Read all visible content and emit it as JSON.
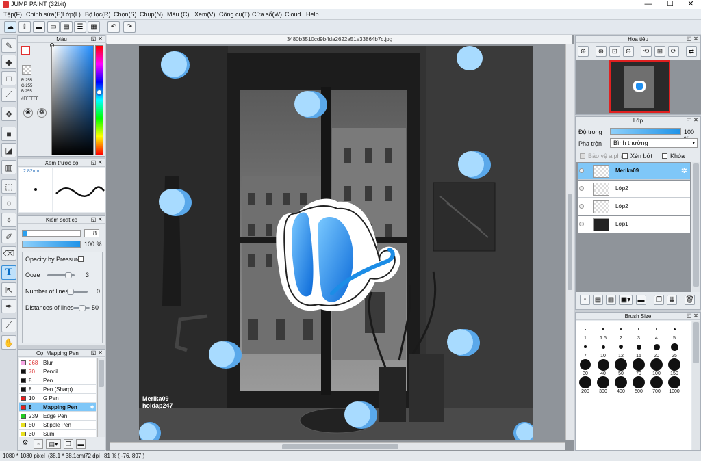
{
  "app": {
    "title": "JUMP PAINT (32bit)"
  },
  "window": {
    "minimize": "—",
    "maximize": "☐",
    "close": "✕"
  },
  "menu": [
    "Tệp(F)",
    "Chỉnh sửa(E)",
    "Lớp(L)",
    "Bộ lọc(R)",
    "Chọn(S)",
    "Chụp(N)",
    "Màu (C)",
    "Xem(V)",
    "Công cụ(T)",
    "Cửa sổ(W)",
    "Cloud",
    "Help"
  ],
  "toolbar": {
    "undo_icon": "undo-icon",
    "redo_icon": "redo-icon"
  },
  "color": {
    "title": "Màu",
    "r": "R:255",
    "g": "G:255",
    "b": "B:255",
    "hex": "#FFFFFF",
    "fg": "#ffffff",
    "accent": "#e03030"
  },
  "preview": {
    "title": "Xem trước cọ",
    "size": "2.82mm"
  },
  "brush_control": {
    "title": "Kiểm soát cọ",
    "size_value": "8",
    "opacity_value": "100 %",
    "opacity_pressure": "Opacity by Pressure",
    "ooze_label": "Ooze",
    "ooze_value": "3",
    "lines_label": "Number of lines",
    "lines_value": "0",
    "dist_label": "Distances of lines",
    "dist_value": "50"
  },
  "brushes": {
    "title": "Cọ: Mapping Pen",
    "items": [
      {
        "size": "268",
        "name": "Blur",
        "color": "#f7a8e6",
        "sizecolor": "#d33"
      },
      {
        "size": "70",
        "name": "Pencil",
        "color": "#111111",
        "sizecolor": "#d33"
      },
      {
        "size": "8",
        "name": "Pen",
        "color": "#111111",
        "sizecolor": "#111"
      },
      {
        "size": "8",
        "name": "Pen (Sharp)",
        "color": "#111111",
        "sizecolor": "#111"
      },
      {
        "size": "10",
        "name": "G Pen",
        "color": "#e82020",
        "sizecolor": "#111"
      },
      {
        "size": "8",
        "name": "Mapping Pen",
        "color": "#e82020",
        "sizecolor": "#111"
      },
      {
        "size": "239",
        "name": "Edge Pen",
        "color": "#22cc22",
        "sizecolor": "#111"
      },
      {
        "size": "50",
        "name": "Stipple Pen",
        "color": "#e8e020",
        "sizecolor": "#111"
      },
      {
        "size": "30",
        "name": "Sumi",
        "color": "#e8e020",
        "sizecolor": "#111"
      }
    ],
    "selected_index": 5
  },
  "document": {
    "tab": "3480b3510cd9b4da2622a51e33864b7c.jpg",
    "watermark_line1": "Merika09",
    "watermark_line2": "hoidap247"
  },
  "navigator": {
    "title": "Hoa tiêu"
  },
  "layers": {
    "title": "Lớp",
    "opacity_label": "Độ trong",
    "opacity_value": "100 %",
    "blend_label": "Pha trộn",
    "blend_value": "Bình thường",
    "protect_alpha": "Bảo vệ alpha",
    "clipping": "Xén bớt",
    "lock": "Khóa",
    "items": [
      "Merika09",
      "Lớp2",
      "Lớp2",
      "Lớp1"
    ],
    "selected_index": 0
  },
  "brush_size": {
    "title": "Brush Size",
    "sizes": [
      "1",
      "1.5",
      "2",
      "3",
      "4",
      "5",
      "7",
      "10",
      "12",
      "15",
      "20",
      "25",
      "30",
      "40",
      "50",
      "70",
      "100",
      "150",
      "200",
      "300",
      "400",
      "500",
      "700",
      "1000"
    ]
  },
  "status": {
    "dimensions": "1080 * 1080 pixel",
    "physical": "(38.1 * 38.1cm)",
    "dpi": "72 dpi",
    "zoom": "81 %",
    "coords": "( -76, 897 )"
  }
}
